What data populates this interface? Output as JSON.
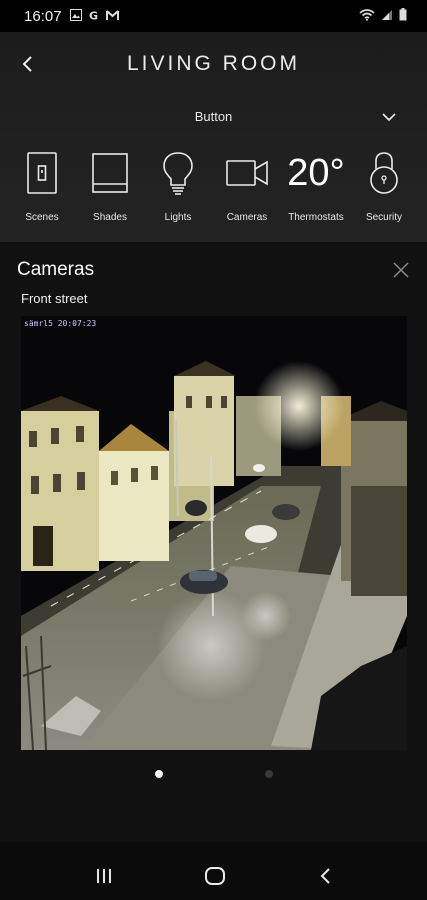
{
  "status_bar": {
    "time": "16:07",
    "left_icons": [
      "gallery-icon",
      "google-icon",
      "gmail-icon"
    ],
    "right_icons": [
      "wifi-icon",
      "signal-icon",
      "battery-icon"
    ]
  },
  "header": {
    "title": "LIVING ROOM",
    "dropdown_label": "Button"
  },
  "categories": [
    {
      "id": "scenes",
      "label": "Scenes",
      "icon": "light-switch-icon"
    },
    {
      "id": "shades",
      "label": "Shades",
      "icon": "window-shade-icon"
    },
    {
      "id": "lights",
      "label": "Lights",
      "icon": "light-bulb-icon"
    },
    {
      "id": "cameras",
      "label": "Cameras",
      "icon": "video-camera-icon"
    },
    {
      "id": "thermostats",
      "label": "Thermostats",
      "value": "20°"
    },
    {
      "id": "security",
      "label": "Security",
      "icon": "padlock-icon"
    }
  ],
  "cameras_panel": {
    "title": "Cameras",
    "camera_name": "Front street",
    "timestamp": "sämrl5 20:07:23",
    "pages": {
      "current": 1,
      "total": 2
    }
  },
  "colors": {
    "background": "#0b0b0b",
    "header": "#1f1f1f",
    "text": "#ffffff"
  }
}
